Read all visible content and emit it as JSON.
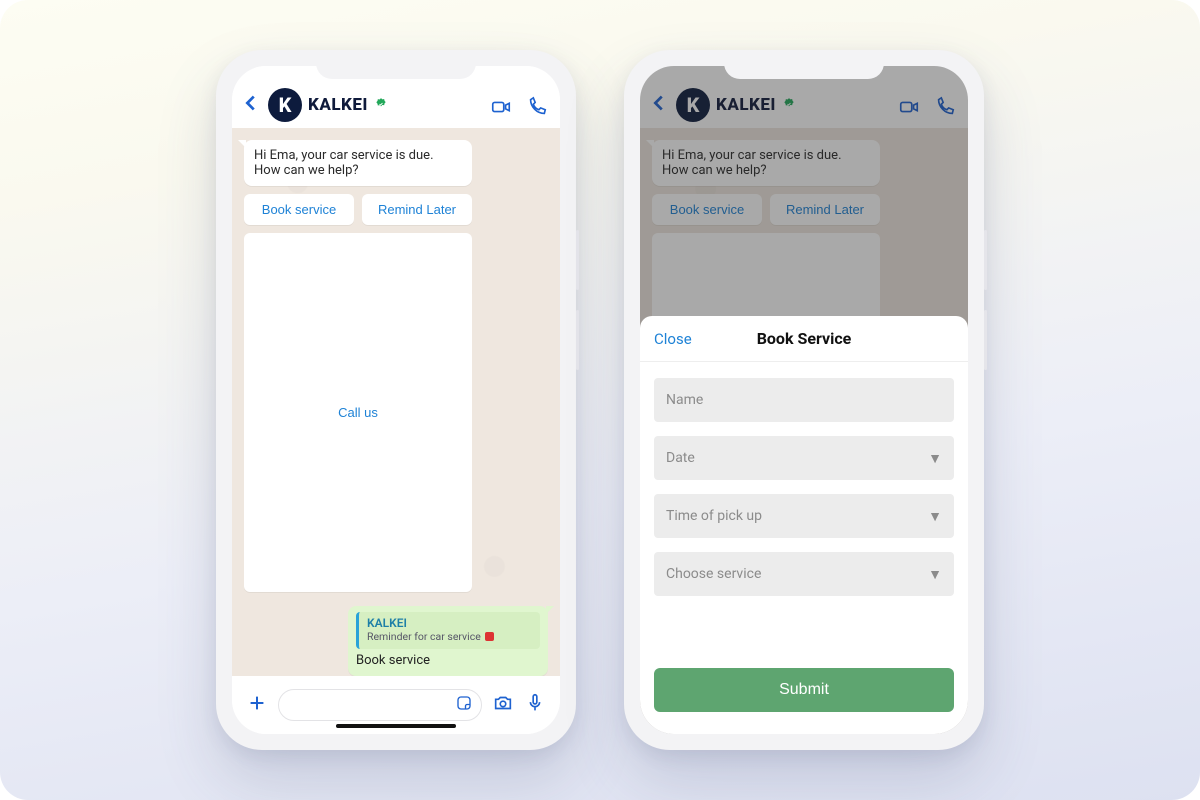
{
  "brand": {
    "name": "KALKEI",
    "initial": "K"
  },
  "chat": {
    "incoming": "Hi Ema, your car service is due. How can we help?",
    "buttons": {
      "book": "Book service",
      "remind": "Remind Later",
      "call": "Call us"
    },
    "quote": {
      "name": "KALKEI",
      "text": "Reminder for car service"
    },
    "reply": "Book service"
  },
  "sheet": {
    "close": "Close",
    "title": "Book Service",
    "fields": {
      "name": "Name",
      "date": "Date",
      "time": "Time of pick up",
      "service": "Choose service"
    },
    "submit": "Submit"
  }
}
